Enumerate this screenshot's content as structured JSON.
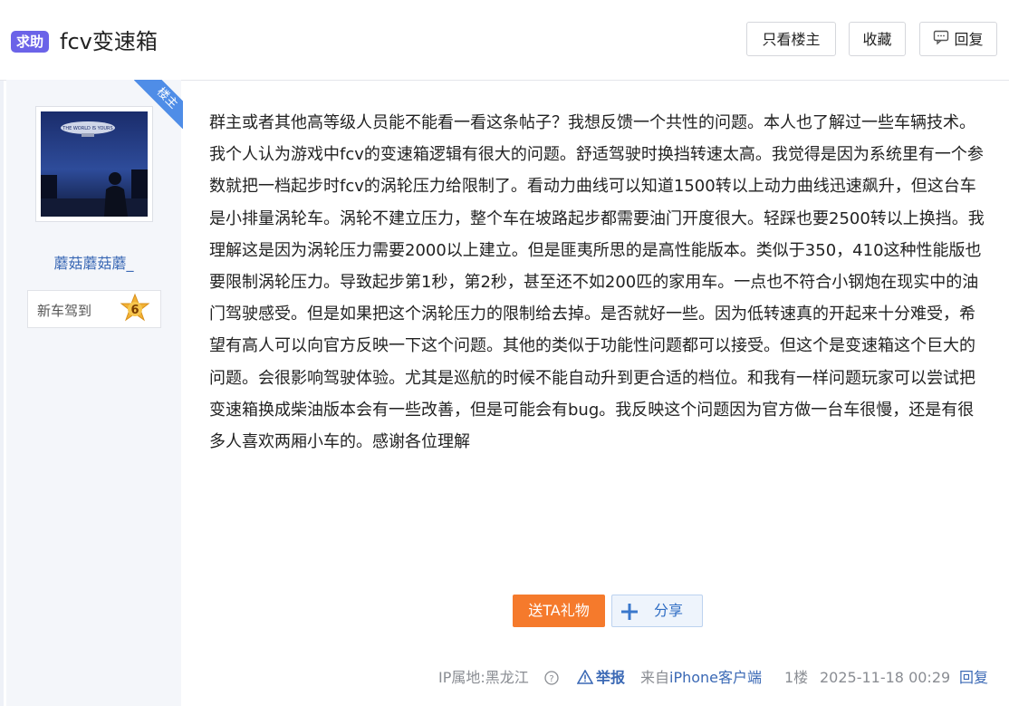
{
  "header": {
    "tag": "求助",
    "title": "fcv变速箱",
    "buttons": {
      "only_op": "只看楼主",
      "favorite": "收藏",
      "reply": "回复"
    }
  },
  "author": {
    "op_ribbon": "楼主",
    "username": "蘑菇蘑菇蘑_",
    "title_badge": "新车驾到",
    "level": "6",
    "avatar_caption": "THE WORLD IS YOURS"
  },
  "post": {
    "body": "群主或者其他高等级人员能不能看一看这条帖子？我想反馈一个共性的问题。本人也了解过一些车辆技术。我个人认为游戏中fcv的变速箱逻辑有很大的问题。舒适驾驶时换挡转速太高。我觉得是因为系统里有一个参数就把一档起步时fcv的涡轮压力给限制了。看动力曲线可以知道1500转以上动力曲线迅速飙升，但这台车是小排量涡轮车。涡轮不建立压力，整个车在坡路起步都需要油门开度很大。轻踩也要2500转以上换挡。我理解这是因为涡轮压力需要2000以上建立。但是匪夷所思的是高性能版本。类似于350，410这种性能版也要限制涡轮压力。导致起步第1秒，第2秒，甚至还不如200匹的家用车。一点也不符合小钢炮在现实中的油门驾驶感受。但是如果把这个涡轮压力的限制给去掉。是否就好一些。因为低转速真的开起来十分难受，希望有高人可以向官方反映一下这个问题。其他的类似于功能性问题都可以接受。但这个是变速箱这个巨大的问题。会很影响驾驶体验。尤其是巡航的时候不能自动升到更合适的档位。和我有一样问题玩家可以尝试把变速箱换成柴油版本会有一些改善，但是可能会有bug。我反映这个问题因为官方做一台车很慢，还是有很多人喜欢两厢小车的。感谢各位理解",
    "gift_button": "送TA礼物",
    "share_button": "分享"
  },
  "meta": {
    "ip": "IP属地:黑龙江",
    "report": "举报",
    "from_prefix": "来自",
    "from_client": "iPhone客户端",
    "floor": "1楼",
    "timestamp": "2025-11-18 00:29",
    "reply": "回复"
  },
  "colors": {
    "tag_bg": "#6b63e8",
    "link_blue": "#3b69b5",
    "gift_orange": "#f57a2c",
    "ribbon_blue": "#4f8de7"
  },
  "icons": {
    "reply": "comment-icon",
    "share": "plus-share-icon",
    "help": "question-circle-icon",
    "report": "warning-triangle-icon",
    "level": "star-badge-icon"
  }
}
